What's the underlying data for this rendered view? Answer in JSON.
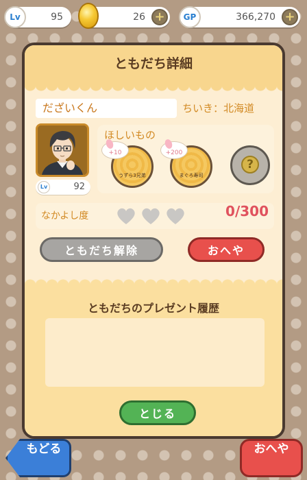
{
  "status_bar": {
    "level_badge": "Lv",
    "level": "95",
    "gold": "26",
    "gp_badge": "GP",
    "gp": "366,270",
    "plus_symbol": "+"
  },
  "dialog": {
    "title": "ともだち詳細",
    "friend_name": "だざいくん",
    "region": "ちいき：北海道",
    "friend_level_badge": "Lv",
    "friend_level": "92",
    "wants_title": "ほしいもの",
    "wants": [
      {
        "bonus": "+10",
        "caption": "うずら3兄弟"
      },
      {
        "bonus": "+200",
        "caption": "まぐろ寿司"
      }
    ],
    "mystery_symbol": "?",
    "friendship_label": "なかよし度",
    "friendship_value": "0/300",
    "hearts_filled": 0,
    "hearts_total": 3,
    "unfriend_button": "ともだち解除",
    "room_button": "おへや",
    "history_title": "ともだちのプレゼント履歴",
    "close_button": "とじる"
  },
  "bottom_nav": {
    "back_button": "もどる",
    "room_button": "おへや"
  },
  "colors": {
    "background": "#b39b84",
    "dialog": "#fdeed3",
    "accent_orange": "#d28a24",
    "red_button": "#e8504c",
    "green_button": "#53b355",
    "blue_button": "#3b7fd8",
    "gray_button": "#a7a5a2"
  },
  "icons": [
    "level-icon",
    "gold-egg-icon",
    "gp-icon",
    "plus-icon",
    "heart-icon",
    "question-icon",
    "sakura-petal-icon"
  ]
}
